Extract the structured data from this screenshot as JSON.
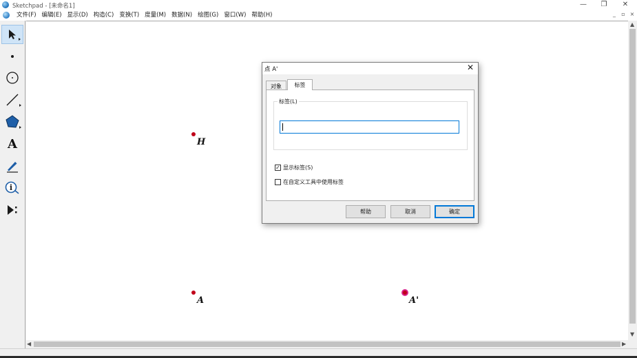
{
  "window": {
    "title": "Sketchpad - [未命名1]",
    "controls": {
      "minimize": "—",
      "restore": "❐",
      "close": "✕"
    },
    "mdi_controls": {
      "minimize": "_",
      "restore": "▫",
      "close": "×"
    }
  },
  "menu": {
    "items": [
      "文件(F)",
      "编辑(E)",
      "显示(D)",
      "构造(C)",
      "变换(T)",
      "度量(M)",
      "数据(N)",
      "绘图(G)",
      "窗口(W)",
      "帮助(H)"
    ]
  },
  "toolbar": {
    "tools": [
      {
        "name": "selection-arrow",
        "icon": "arrow-pointer-icon",
        "active": true
      },
      {
        "name": "point",
        "icon": "point-icon"
      },
      {
        "name": "compass",
        "icon": "circle-icon"
      },
      {
        "name": "straightedge",
        "icon": "line-icon"
      },
      {
        "name": "polygon",
        "icon": "polygon-icon"
      },
      {
        "name": "text",
        "icon": "text-icon",
        "glyph": "A"
      },
      {
        "name": "marker",
        "icon": "pen-icon"
      },
      {
        "name": "information",
        "icon": "info-icon",
        "glyph": "i"
      },
      {
        "name": "custom-tools",
        "icon": "custom-tool-icon"
      }
    ]
  },
  "canvas": {
    "points": [
      {
        "label": "H",
        "selected": false,
        "color": "#c0001a"
      },
      {
        "label": "A",
        "selected": false,
        "color": "#c0001a"
      },
      {
        "label": "A'",
        "selected": true,
        "color": "#c0001a",
        "highlight": "#d8238a"
      }
    ]
  },
  "dialog": {
    "title": "点 A'",
    "tabs": [
      {
        "label": "对象",
        "active": false
      },
      {
        "label": "标签",
        "active": true
      }
    ],
    "group_label": "标签(L)",
    "label_input_value": "",
    "checkboxes": [
      {
        "label": "显示标签(S)",
        "checked": true
      },
      {
        "label": "在自定义工具中使用标签",
        "checked": false
      }
    ],
    "buttons": {
      "help": "帮助",
      "cancel": "取消",
      "ok": "确定"
    }
  },
  "colors": {
    "accent": "#0078d7",
    "point": "#c0001a",
    "selection": "#d8238a"
  }
}
